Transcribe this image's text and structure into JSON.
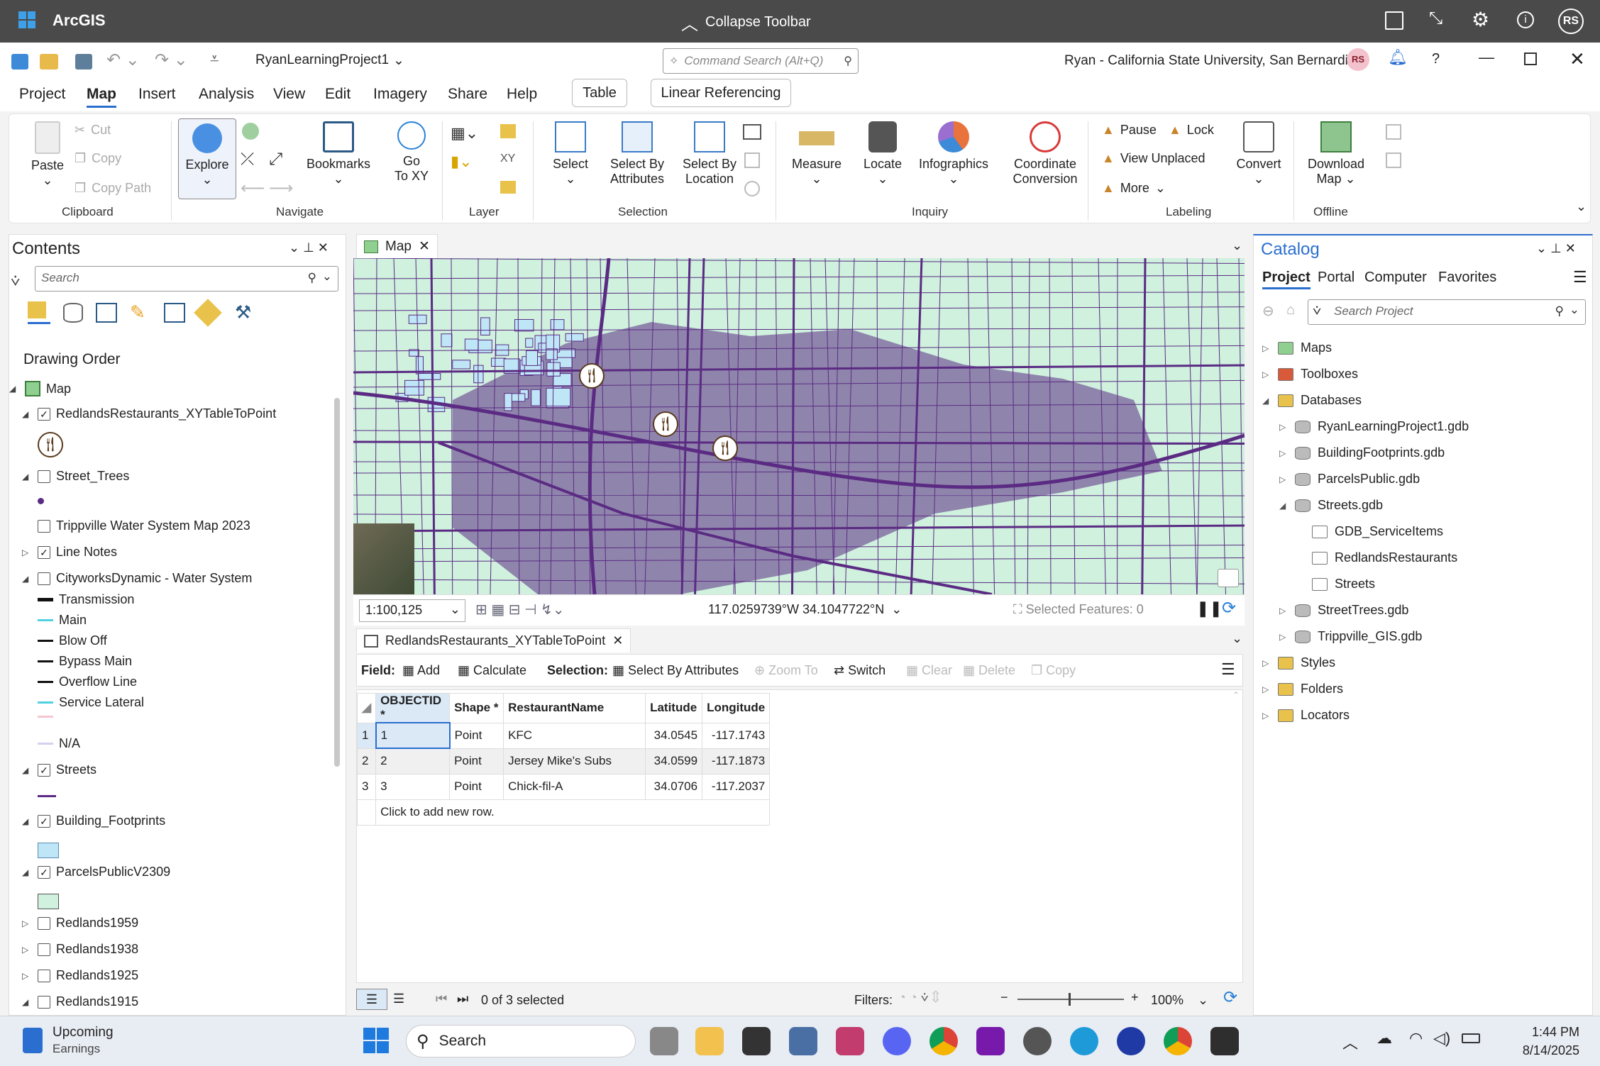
{
  "titlebar": {
    "app_name": "ArcGIS",
    "collapse_toolbar": "Collapse Toolbar",
    "user_initials": "RS"
  },
  "qat": {
    "project_name": "RyanLearningProject1",
    "command_search_placeholder": "Command Search (Alt+Q)",
    "user_org": "Ryan - California State University, San Bernardino",
    "user_initials": "RS"
  },
  "menu": {
    "tabs": [
      "Project",
      "Map",
      "Insert",
      "Analysis",
      "View",
      "Edit",
      "Imagery",
      "Share",
      "Help"
    ],
    "active": "Map",
    "table_tab": "Table",
    "linear_referencing_tab": "Linear Referencing"
  },
  "ribbon": {
    "clipboard": {
      "paste": "Paste",
      "cut": "Cut",
      "copy": "Copy",
      "copy_path": "Copy Path",
      "label": "Clipboard"
    },
    "navigate": {
      "explore": "Explore",
      "bookmarks": "Bookmarks",
      "go_to_xy_1": "Go",
      "go_to_xy_2": "To XY",
      "label": "Navigate"
    },
    "layer": {
      "label": "Layer"
    },
    "selection": {
      "select": "Select",
      "sba_1": "Select By",
      "sba_2": "Attributes",
      "sbl_1": "Select By",
      "sbl_2": "Location",
      "label": "Selection"
    },
    "inquiry": {
      "measure": "Measure",
      "locate": "Locate",
      "infographics": "Infographics",
      "coord_1": "Coordinate",
      "coord_2": "Conversion",
      "label": "Inquiry"
    },
    "labeling": {
      "pause": "Pause",
      "lock": "Lock",
      "view_unplaced": "View Unplaced",
      "more": "More",
      "convert": "Convert",
      "label": "Labeling"
    },
    "offline": {
      "download_1": "Download",
      "download_2": "Map",
      "label": "Offline"
    }
  },
  "contents": {
    "title": "Contents",
    "search_placeholder": "Search",
    "drawing_order": "Drawing Order",
    "layers": [
      {
        "name": "Map",
        "type": "map"
      },
      {
        "name": "RedlandsRestaurants_XYTableToPoint",
        "checked": true
      },
      {
        "name": "Street_Trees",
        "checked": false
      },
      {
        "name": "Trippville Water System Map 2023",
        "checked": false
      },
      {
        "name": "Line Notes",
        "checked": true
      },
      {
        "name": "CityworksDynamic - Water System",
        "checked": false
      },
      {
        "name": "Streets",
        "checked": true
      },
      {
        "name": "Building_Footprints",
        "checked": true
      },
      {
        "name": "ParcelsPublicV2309",
        "checked": true
      },
      {
        "name": "Redlands1959",
        "checked": false
      },
      {
        "name": "Redlands1938",
        "checked": false
      },
      {
        "name": "Redlands1925",
        "checked": false
      },
      {
        "name": "Redlands1915",
        "checked": false
      }
    ],
    "water_legend": [
      {
        "label": "Transmission",
        "color": "#111111"
      },
      {
        "label": "Main",
        "color": "#4fd1e0"
      },
      {
        "label": "Blow Off",
        "color": "#111111"
      },
      {
        "label": "Bypass Main",
        "color": "#111111"
      },
      {
        "label": "Overflow Line",
        "color": "#111111"
      },
      {
        "label": "Service Lateral",
        "color": "#4fd1e0"
      },
      {
        "label": "",
        "color": "#f5c6d0"
      },
      {
        "label": "N/A",
        "color": "#d8d0ee"
      }
    ]
  },
  "map": {
    "tab_label": "Map",
    "scale": "1:100,125",
    "coordinates": "117.0259739°W 34.1047722°N",
    "selected_features": "Selected Features: 0",
    "colors": {
      "parcel_fill": "#cff1de",
      "streets": "#5b2b83",
      "buildings": "#bfe6f7"
    }
  },
  "table": {
    "tab_label": "RedlandsRestaurants_XYTableToPoint",
    "field_label": "Field:",
    "add": "Add",
    "calculate": "Calculate",
    "selection_label": "Selection:",
    "select_by_attributes": "Select By Attributes",
    "zoom_to": "Zoom To",
    "switch": "Switch",
    "clear": "Clear",
    "delete": "Delete",
    "copy": "Copy",
    "columns": [
      "OBJECTID *",
      "Shape *",
      "RestaurantName",
      "Latitude",
      "Longitude"
    ],
    "rows": [
      {
        "n": "1",
        "oid": "1",
        "shape": "Point",
        "name": "KFC",
        "lat": "34.0545",
        "lon": "-117.1743"
      },
      {
        "n": "2",
        "oid": "2",
        "shape": "Point",
        "name": "Jersey Mike's Subs",
        "lat": "34.0599",
        "lon": "-117.1873"
      },
      {
        "n": "3",
        "oid": "3",
        "shape": "Point",
        "name": "Chick-fil-A",
        "lat": "34.0706",
        "lon": "-117.2037"
      }
    ],
    "add_row": "Click to add new row.",
    "selected_count": "0 of 3 selected",
    "filters": "Filters:",
    "zoom_pct": "100%"
  },
  "catalog": {
    "title": "Catalog",
    "tabs": [
      "Project",
      "Portal",
      "Computer",
      "Favorites"
    ],
    "active_tab": "Project",
    "search_placeholder": "Search Project",
    "tree": [
      {
        "label": "Maps",
        "level": 0,
        "expand": "closed",
        "icon": "maps-folder-icon"
      },
      {
        "label": "Toolboxes",
        "level": 0,
        "expand": "closed",
        "icon": "toolbox-folder-icon"
      },
      {
        "label": "Databases",
        "level": 0,
        "expand": "open",
        "icon": "database-folder-icon"
      },
      {
        "label": "RyanLearningProject1.gdb",
        "level": 1,
        "expand": "closed",
        "icon": "gdb-home-icon"
      },
      {
        "label": "BuildingFootprints.gdb",
        "level": 1,
        "expand": "closed",
        "icon": "gdb-icon"
      },
      {
        "label": "ParcelsPublic.gdb",
        "level": 1,
        "expand": "closed",
        "icon": "gdb-icon"
      },
      {
        "label": "Streets.gdb",
        "level": 1,
        "expand": "open",
        "icon": "gdb-icon"
      },
      {
        "label": "GDB_ServiceItems",
        "level": 2,
        "expand": "none",
        "icon": "table-icon"
      },
      {
        "label": "RedlandsRestaurants",
        "level": 2,
        "expand": "none",
        "icon": "table-icon"
      },
      {
        "label": "Streets",
        "level": 2,
        "expand": "none",
        "icon": "line-fc-icon"
      },
      {
        "label": "StreetTrees.gdb",
        "level": 1,
        "expand": "closed",
        "icon": "gdb-icon"
      },
      {
        "label": "Trippville_GIS.gdb",
        "level": 1,
        "expand": "closed",
        "icon": "gdb-icon"
      },
      {
        "label": "Styles",
        "level": 0,
        "expand": "closed",
        "icon": "styles-folder-icon"
      },
      {
        "label": "Folders",
        "level": 0,
        "expand": "closed",
        "icon": "folder-icon"
      },
      {
        "label": "Locators",
        "level": 0,
        "expand": "closed",
        "icon": "locators-folder-icon"
      }
    ]
  },
  "taskbar": {
    "weather_title": "Upcoming",
    "weather_sub": "Earnings",
    "search": "Search",
    "time": "1:44 PM",
    "date": "8/14/2025"
  }
}
